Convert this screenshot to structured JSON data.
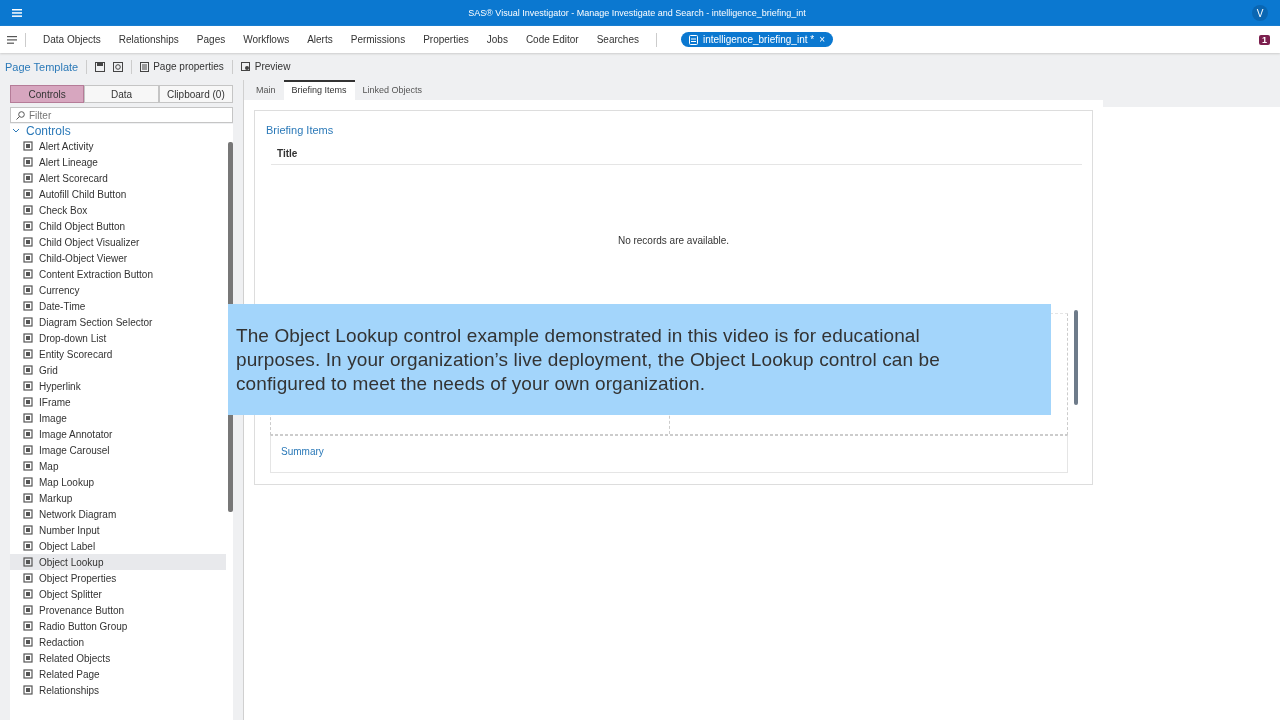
{
  "window": {
    "title": "SAS® Visual Investigator - Manage Investigate and Search - intelligence_briefing_int",
    "user_initial": "V"
  },
  "nav": {
    "items": [
      "Data Objects",
      "Relationships",
      "Pages",
      "Workflows",
      "Alerts",
      "Permissions",
      "Properties",
      "Jobs",
      "Code Editor",
      "Searches"
    ],
    "open_tab": {
      "label": "intelligence_briefing_int *",
      "close": "×"
    },
    "notification_count": "1"
  },
  "toolbar": {
    "title": "Page Template",
    "page_properties": "Page properties",
    "preview": "Preview"
  },
  "panel_tabs": [
    {
      "label": "Controls",
      "selected": true
    },
    {
      "label": "Data",
      "selected": false
    },
    {
      "label": "Clipboard (0)",
      "selected": false
    }
  ],
  "filter": {
    "placeholder": "Filter"
  },
  "controls_group": {
    "label": "Controls",
    "expanded": true
  },
  "controls": [
    {
      "label": "Alert Activity",
      "selected": false
    },
    {
      "label": "Alert Lineage",
      "selected": false
    },
    {
      "label": "Alert Scorecard",
      "selected": false
    },
    {
      "label": "Autofill Child Button",
      "selected": false
    },
    {
      "label": "Check Box",
      "selected": false
    },
    {
      "label": "Child Object Button",
      "selected": false
    },
    {
      "label": "Child Object Visualizer",
      "selected": false
    },
    {
      "label": "Child-Object Viewer",
      "selected": false
    },
    {
      "label": "Content Extraction Button",
      "selected": false
    },
    {
      "label": "Currency",
      "selected": false
    },
    {
      "label": "Date-Time",
      "selected": false
    },
    {
      "label": "Diagram Section Selector",
      "selected": false
    },
    {
      "label": "Drop-down List",
      "selected": false
    },
    {
      "label": "Entity Scorecard",
      "selected": false
    },
    {
      "label": "Grid",
      "selected": false
    },
    {
      "label": "Hyperlink",
      "selected": false
    },
    {
      "label": "IFrame",
      "selected": false
    },
    {
      "label": "Image",
      "selected": false
    },
    {
      "label": "Image Annotator",
      "selected": false
    },
    {
      "label": "Image Carousel",
      "selected": false
    },
    {
      "label": "Map",
      "selected": false
    },
    {
      "label": "Map Lookup",
      "selected": false
    },
    {
      "label": "Markup",
      "selected": false
    },
    {
      "label": "Network Diagram",
      "selected": false
    },
    {
      "label": "Number Input",
      "selected": false
    },
    {
      "label": "Object Label",
      "selected": false
    },
    {
      "label": "Object Lookup",
      "selected": true
    },
    {
      "label": "Object Properties",
      "selected": false
    },
    {
      "label": "Object Splitter",
      "selected": false
    },
    {
      "label": "Provenance Button",
      "selected": false
    },
    {
      "label": "Radio Button Group",
      "selected": false
    },
    {
      "label": "Redaction",
      "selected": false
    },
    {
      "label": "Related Objects",
      "selected": false
    },
    {
      "label": "Related Page",
      "selected": false
    },
    {
      "label": "Relationships",
      "selected": false
    }
  ],
  "page_tabs": [
    {
      "label": "Main",
      "selected": false
    },
    {
      "label": "Briefing Items",
      "selected": true
    },
    {
      "label": "Linked Objects",
      "selected": false
    }
  ],
  "section": {
    "title": "Briefing Items",
    "table": {
      "columns": [
        "Title"
      ],
      "empty_message": "No records are available."
    },
    "summary_label": "Summary"
  },
  "caption": "The Object Lookup control example demonstrated in this video is for educational purposes. In your organization’s live deployment, the Object Lookup control can be configured to meet the needs of your own organization."
}
